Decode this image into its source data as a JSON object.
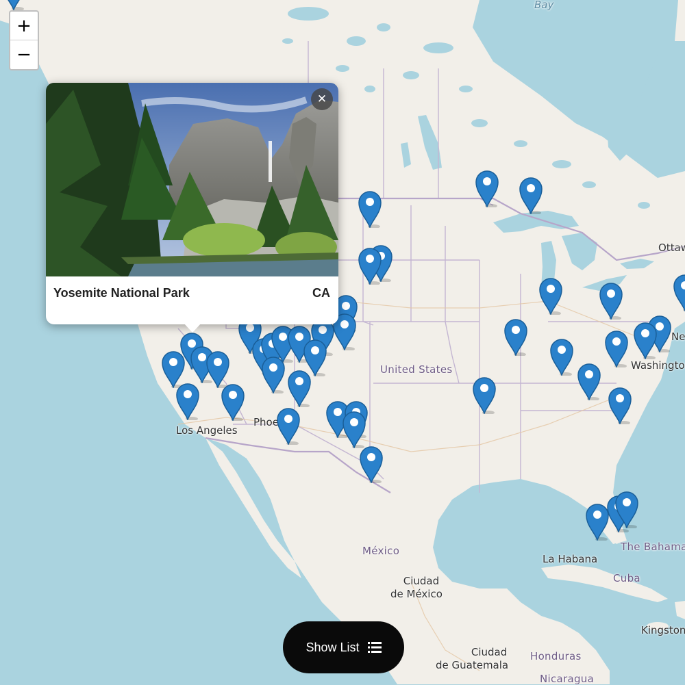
{
  "map": {
    "colors": {
      "water": "#aad3df",
      "land": "#f2efe9",
      "border": "#b7a5c9",
      "marker": "#2a81cb",
      "marker_dark": "#1a5f99"
    },
    "labels": {
      "bay": "Bay",
      "ottawa": "Ottawa",
      "new_york": "Ne",
      "washington": "Washington",
      "united_states": "United States",
      "los_angeles": "Los Angeles",
      "phoenix": "Phoe",
      "mexico": "México",
      "ciudad_de_mexico_line1": "Ciudad",
      "ciudad_de_mexico_line2": "de México",
      "la_habana": "La Habana",
      "cuba": "Cuba",
      "bahamas": "The Bahama",
      "kingston": "Kingston",
      "honduras": "Honduras",
      "ciudad_de_guatemala_line1": "Ciudad",
      "ciudad_de_guatemala_line2": "de Guatemala",
      "nicaragua": "Nicaragua"
    }
  },
  "zoom": {
    "in_label": "+",
    "out_label": "−"
  },
  "markers": {
    "icon": "map-pin-icon",
    "count": 42
  },
  "popup": {
    "title": "Yosemite National Park",
    "state": "CA",
    "close_label": "✕",
    "image_icon": "landscape-photo"
  },
  "show_list": {
    "label": "Show List",
    "icon": "list-icon"
  }
}
